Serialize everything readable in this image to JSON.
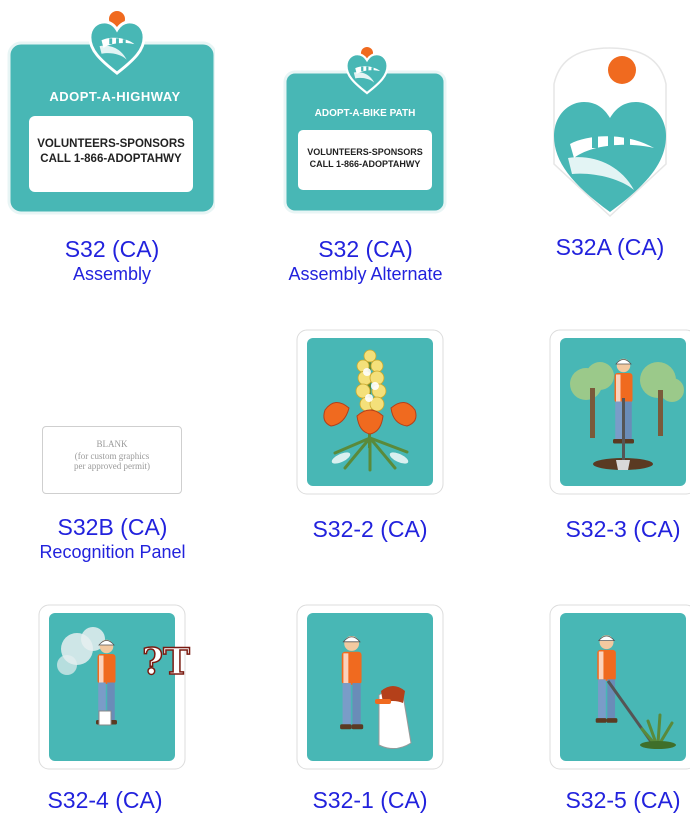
{
  "colors": {
    "teal": "#48b7b5",
    "orange": "#f06a1f",
    "label_blue": "#2222dd"
  },
  "signs": {
    "s32": {
      "code": "S32 (CA)",
      "caption": "Assembly",
      "banner": "ADOPT-A-HIGHWAY",
      "panel_line1": "VOLUNTEERS-SPONSORS",
      "panel_line2": "CALL 1-866-ADOPTAHWY"
    },
    "s32_alt": {
      "code": "S32 (CA)",
      "caption": "Assembly Alternate",
      "banner": "ADOPT-A-BIKE PATH",
      "panel_line1": "VOLUNTEERS-SPONSORS",
      "panel_line2": "CALL 1-866-ADOPTAHWY"
    },
    "s32a": {
      "code": "S32A (CA)"
    },
    "s32b": {
      "code": "S32B (CA)",
      "caption": "Recognition Panel",
      "blank_title": "BLANK",
      "blank_line1": "(for custom graphics",
      "blank_line2": "per approved permit)"
    },
    "s32_2": {
      "code": "S32-2 (CA)",
      "icon": "wildflowers-icon"
    },
    "s32_3": {
      "code": "S32-3 (CA)",
      "icon": "tree-planting-worker-icon"
    },
    "s32_4": {
      "code": "S32-4 (CA)",
      "graffiti_text": "?T",
      "icon": "graffiti-removal-worker-icon"
    },
    "s32_1": {
      "code": "S32-1 (CA)",
      "icon": "litter-pickup-worker-icon"
    },
    "s32_5": {
      "code": "S32-5 (CA)",
      "icon": "weed-removal-worker-icon"
    }
  }
}
